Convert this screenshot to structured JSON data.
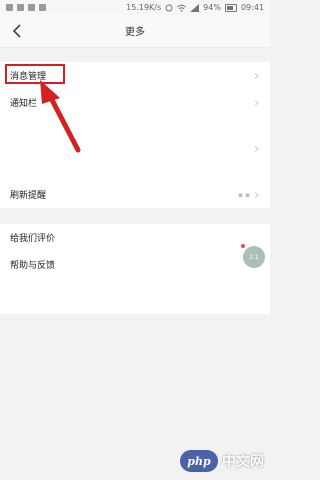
{
  "status_bar": {
    "speed": "15.19K/s",
    "battery_pct": "94%",
    "time": "09:41"
  },
  "header": {
    "title": "更多"
  },
  "menu": {
    "items": [
      {
        "label": "消息管理"
      },
      {
        "label": "通知栏"
      },
      {
        "label": "刷新提醒"
      },
      {
        "label": "给我们评价"
      },
      {
        "label": "帮助与反馈"
      }
    ]
  },
  "annotation": {
    "highlight_color": "#d32020",
    "arrow_color": "#d32020"
  },
  "floating_button": {
    "label": "2:1"
  },
  "watermark": {
    "logo": "php",
    "text": "中文网"
  }
}
